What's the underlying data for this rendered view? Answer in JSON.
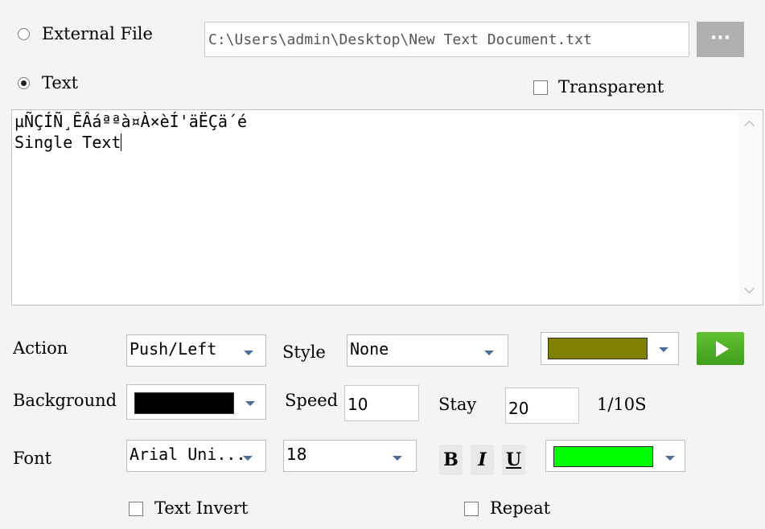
{
  "source": {
    "external_file_label": "External File",
    "file_path": "C:\\Users\\admin\\Desktop\\New Text Document.txt",
    "browse_label": "···",
    "text_label": "Text",
    "selected": "text"
  },
  "transparent": {
    "label": "Transparent",
    "checked": false
  },
  "editor": {
    "line1": "µÑÇÍÑ¸ÊÂáªªà¤À×èÍ'äËÇä´é",
    "line2": "Single Text"
  },
  "action": {
    "label": "Action",
    "value": "Push/Left"
  },
  "style": {
    "label": "Style",
    "value": "None"
  },
  "style_color": "#808000",
  "background": {
    "label": "Background",
    "color": "#000000"
  },
  "speed": {
    "label": "Speed",
    "value": "10"
  },
  "stay": {
    "label": "Stay",
    "value": "20",
    "unit": "1/10S"
  },
  "font": {
    "label": "Font",
    "name": "Arial Uni...",
    "size": "18",
    "color": "#00ff00"
  },
  "format_buttons": {
    "bold": "B",
    "italic": "I",
    "underline": "U"
  },
  "text_invert": {
    "label": "Text Invert",
    "checked": false
  },
  "repeat": {
    "label": "Repeat",
    "checked": false
  }
}
